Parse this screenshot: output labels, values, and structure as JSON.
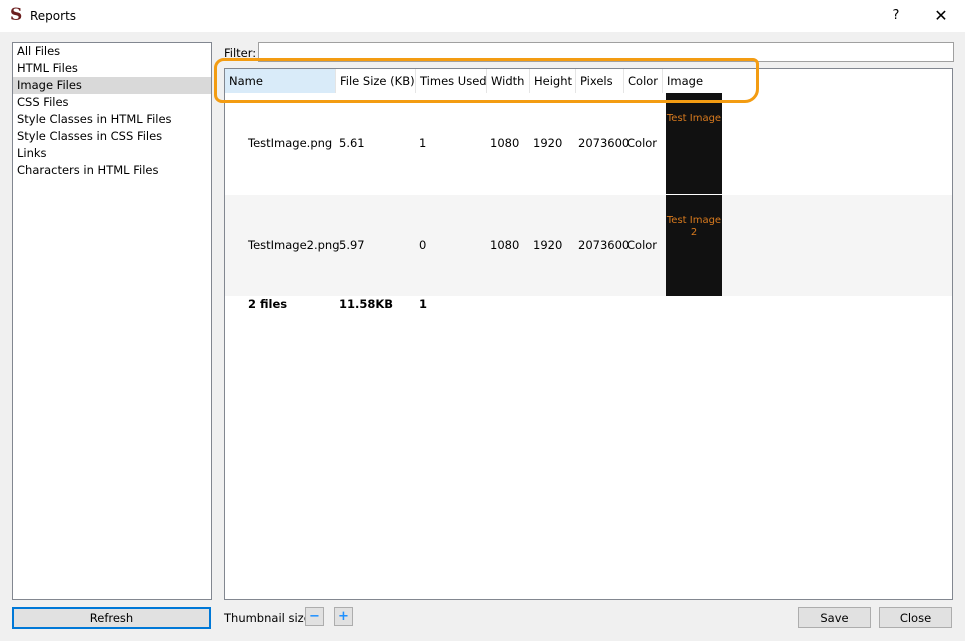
{
  "window": {
    "app_logo": "S",
    "title": "Reports",
    "help": "?",
    "close": "✕"
  },
  "sidebar": {
    "items": [
      {
        "label": "All Files"
      },
      {
        "label": "HTML Files"
      },
      {
        "label": "Image Files"
      },
      {
        "label": "CSS Files"
      },
      {
        "label": "Style Classes in HTML Files"
      },
      {
        "label": "Style Classes in CSS Files"
      },
      {
        "label": "Links"
      },
      {
        "label": "Characters in HTML Files"
      }
    ],
    "selected": "Image Files"
  },
  "filter": {
    "label": "Filter:",
    "value": ""
  },
  "table": {
    "columns": [
      "Name",
      "File Size (KB)",
      "Times Used",
      "Width",
      "Height",
      "Pixels",
      "Color",
      "Image"
    ],
    "sorted_column": "Name",
    "rows": [
      {
        "name": "TestImage.png",
        "size": "5.61",
        "used": "1",
        "width": "1080",
        "height": "1920",
        "pixels": "2073600",
        "color": "Color",
        "thumb_text": "Test Image"
      },
      {
        "name": "TestImage2.png",
        "size": "5.97",
        "used": "0",
        "width": "1080",
        "height": "1920",
        "pixels": "2073600",
        "color": "Color",
        "thumb_text": "Test Image 2"
      }
    ],
    "totals": {
      "files": "2 files",
      "size": "11.58KB",
      "used": "1"
    }
  },
  "bottom": {
    "refresh": "Refresh",
    "thumbnail_label": "Thumbnail size:",
    "thumb_minus": "−",
    "thumb_plus": "+",
    "save": "Save",
    "close": "Close"
  },
  "colors": {
    "highlight": "#f39c12",
    "selection": "#d9d9d9",
    "sorted_header": "#d9ebf9"
  }
}
